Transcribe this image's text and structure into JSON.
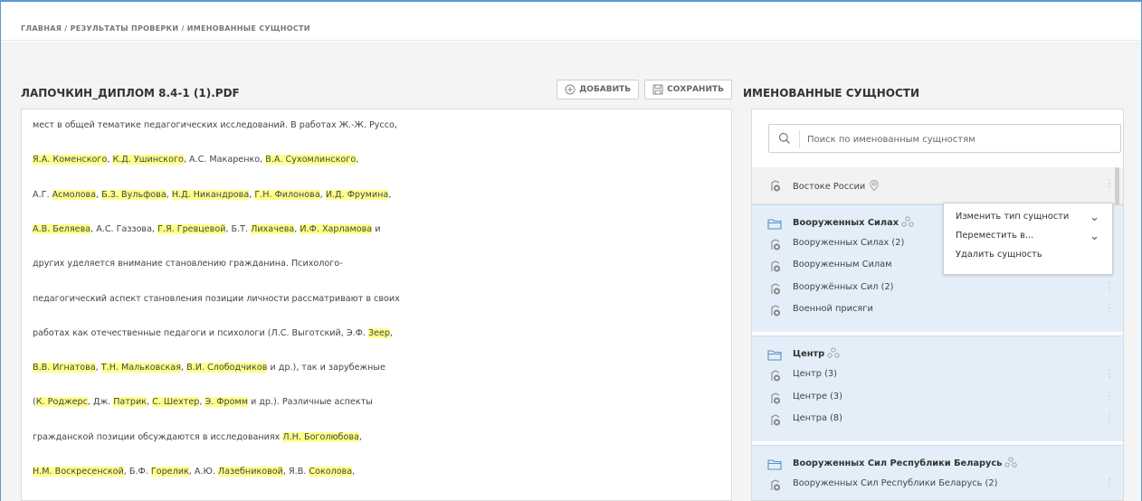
{
  "breadcrumb": "ГЛАВНАЯ / РЕЗУЛЬТАТЫ ПРОВЕРКИ / ИМЕНОВАННЫЕ СУЩНОСТИ",
  "document": {
    "title": "ЛАПОЧКИН_ДИПЛОМ 8.4-1 (1).PDF",
    "add_label": "ДОБАВИТЬ",
    "save_label": "СОХРАНИТЬ",
    "lines": [
      [
        {
          "t": "мест в общей тематике педагогических исследований. В работах Ж.-Ж. Руссо,",
          "h": false
        }
      ],
      [
        {
          "t": "Я.А. Коменского",
          "h": true
        },
        {
          "t": ", ",
          "h": false
        },
        {
          "t": "К.Д. Ушинского",
          "h": true
        },
        {
          "t": ", А.С. Макаренко, ",
          "h": false
        },
        {
          "t": "В.А. Сухомлинского",
          "h": true
        },
        {
          "t": ",",
          "h": false
        }
      ],
      [
        {
          "t": "А.Г. ",
          "h": false
        },
        {
          "t": "Асмолова",
          "h": true
        },
        {
          "t": ", ",
          "h": false
        },
        {
          "t": "Б.З. Вульфова",
          "h": true
        },
        {
          "t": ", ",
          "h": false
        },
        {
          "t": "Н.Д. Никандрова",
          "h": true
        },
        {
          "t": ", ",
          "h": false
        },
        {
          "t": "Г.Н. Филонова",
          "h": true
        },
        {
          "t": ", ",
          "h": false
        },
        {
          "t": "И.Д. Фрумина",
          "h": true
        },
        {
          "t": ",",
          "h": false
        }
      ],
      [
        {
          "t": "А.В. Беляева",
          "h": true
        },
        {
          "t": ", А.С. Газзова, ",
          "h": false
        },
        {
          "t": "Г.Я. Гревцевой",
          "h": true
        },
        {
          "t": ", Б.Т. ",
          "h": false
        },
        {
          "t": "Лихачева",
          "h": true
        },
        {
          "t": ", ",
          "h": false
        },
        {
          "t": "И.Ф. Харламова",
          "h": true
        },
        {
          "t": " и",
          "h": false
        }
      ],
      [
        {
          "t": "других уделяется внимание становлению гражданина. Психолого-",
          "h": false
        }
      ],
      [
        {
          "t": "педагогический аспект становления позиции личности рассматривают в своих",
          "h": false
        }
      ],
      [
        {
          "t": "работах как отечественные педагоги и психологи (Л.С. Выготский, Э.Ф. ",
          "h": false
        },
        {
          "t": "Зеер",
          "h": true
        },
        {
          "t": ",",
          "h": false
        }
      ],
      [
        {
          "t": "В.В. Игнатова",
          "h": true
        },
        {
          "t": ", ",
          "h": false
        },
        {
          "t": "Т.Н. Мальковская",
          "h": true
        },
        {
          "t": ", ",
          "h": false
        },
        {
          "t": "В.И. Слободчиков",
          "h": true
        },
        {
          "t": " и др.), так и зарубежные",
          "h": false
        }
      ],
      [
        {
          "t": "(",
          "h": false
        },
        {
          "t": "К. Роджерс",
          "h": true
        },
        {
          "t": ", Дж. ",
          "h": false
        },
        {
          "t": "Патрик",
          "h": true
        },
        {
          "t": ", ",
          "h": false
        },
        {
          "t": "С. Шехтер",
          "h": true
        },
        {
          "t": ", ",
          "h": false
        },
        {
          "t": "Э. Фромм",
          "h": true
        },
        {
          "t": " и др.). Различные аспекты",
          "h": false
        }
      ],
      [
        {
          "t": "гражданской позиции обсуждаются в исследованиях ",
          "h": false
        },
        {
          "t": "Л.Н. Боголюбова",
          "h": true
        },
        {
          "t": ",",
          "h": false
        }
      ],
      [
        {
          "t": "Н.М. Воскресенской",
          "h": true
        },
        {
          "t": ", Б.Ф. ",
          "h": false
        },
        {
          "t": "Горелик",
          "h": true
        },
        {
          "t": ", А.Ю. ",
          "h": false
        },
        {
          "t": "Лазебниковой",
          "h": true
        },
        {
          "t": ", Я.В. ",
          "h": false
        },
        {
          "t": "Соколова",
          "h": true
        },
        {
          "t": ",",
          "h": false
        }
      ]
    ]
  },
  "entities": {
    "title": "ИМЕНОВАННЫЕ СУЩНОСТИ",
    "search_placeholder": "Поиск по именованным сущностям",
    "standalone": {
      "label": "Востоке России",
      "type_icon": "location-icon"
    },
    "groups": [
      {
        "label": "Вооруженных Силах",
        "items": [
          "Вооруженных Силах (2)",
          "Вооруженным Силам",
          "Вооружённых Сил (2)",
          "Военной присяги"
        ]
      },
      {
        "label": "Центр",
        "items": [
          "Центр (3)",
          "Центре (3)",
          "Центра (8)"
        ]
      },
      {
        "label": "Вооруженных Сил Республики Беларусь",
        "items": [
          "Вооруженных Сил Республики Беларусь (2)"
        ]
      }
    ]
  },
  "context_menu": {
    "items": [
      {
        "label": "Изменить тип сущности",
        "submenu": true
      },
      {
        "label": "Переместить в...",
        "submenu": true
      },
      {
        "label": "Удалить сущность",
        "submenu": false
      }
    ]
  },
  "colors": {
    "accent": "#5b9bd5",
    "highlight": "#ffff8c",
    "group_bg": "#e3eef8"
  }
}
